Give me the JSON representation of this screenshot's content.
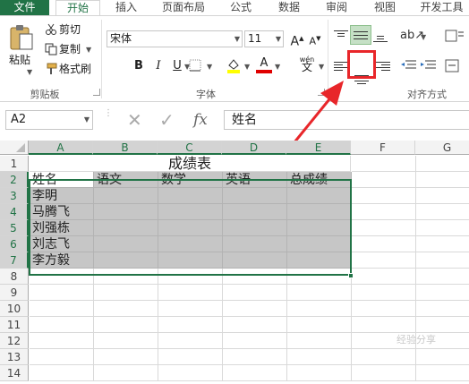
{
  "ribbon_tabs": [
    {
      "label": "文件",
      "active": false,
      "is_file": true
    },
    {
      "label": "开始",
      "active": true
    },
    {
      "label": "插入",
      "active": false
    },
    {
      "label": "页面布局",
      "active": false
    },
    {
      "label": "公式",
      "active": false
    },
    {
      "label": "数据",
      "active": false
    },
    {
      "label": "审阅",
      "active": false
    },
    {
      "label": "视图",
      "active": false
    },
    {
      "label": "开发工具",
      "active": false
    }
  ],
  "clipboard": {
    "paste_label": "粘贴",
    "cut_label": "剪切",
    "copy_label": "复制",
    "format_painter_label": "格式刷",
    "group_label": "剪贴板"
  },
  "font": {
    "font_name": "宋体",
    "font_size": "11",
    "bold": "B",
    "italic": "I",
    "underline": "U",
    "grow": "A",
    "shrink": "A",
    "phonetic": "wén",
    "group_label": "字体"
  },
  "alignment": {
    "group_label": "对齐方式",
    "center_selected": true
  },
  "formula_bar": {
    "name_box": "A2",
    "fx_label": "fx",
    "formula_value": "姓名"
  },
  "columns": [
    "A",
    "B",
    "C",
    "D",
    "E",
    "F",
    "G"
  ],
  "rows": [
    "1",
    "2",
    "3",
    "4",
    "5",
    "6",
    "7",
    "8",
    "9",
    "10",
    "11",
    "12",
    "13",
    "14"
  ],
  "sheet": {
    "title": "成绩表",
    "headers": [
      "姓名",
      "语文",
      "数学",
      "英语",
      "总成绩"
    ],
    "names": [
      "李明",
      "马腾飞",
      "刘强栋",
      "刘志飞",
      "李方毅"
    ]
  },
  "watermark": "经验分享",
  "colors": {
    "accent": "#217346",
    "highlight": "#e8262a",
    "selection": "#c6c6c6"
  }
}
